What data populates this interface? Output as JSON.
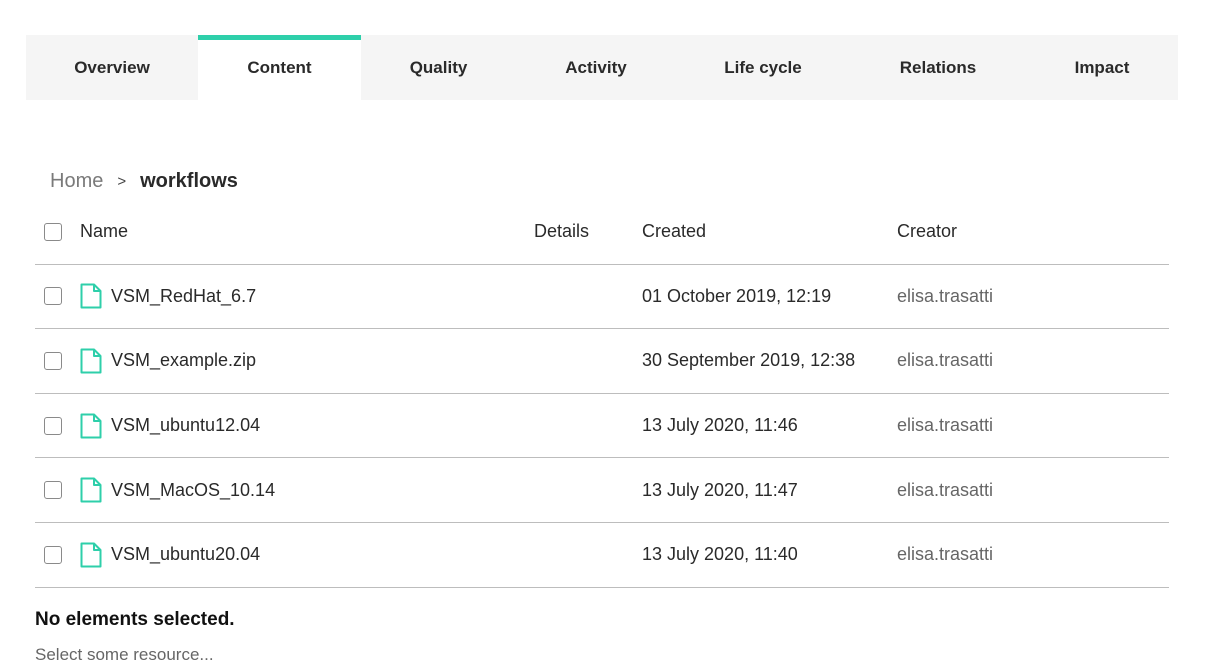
{
  "tabs": [
    {
      "label": "Overview"
    },
    {
      "label": "Content"
    },
    {
      "label": "Quality"
    },
    {
      "label": "Activity"
    },
    {
      "label": "Life cycle"
    },
    {
      "label": "Relations"
    },
    {
      "label": "Impact"
    }
  ],
  "active_tab": "Content",
  "accent_color": "#2ecfaa",
  "breadcrumb": {
    "home": "Home",
    "separator": ">",
    "current": "workflows"
  },
  "table": {
    "columns": {
      "name": "Name",
      "details": "Details",
      "created": "Created",
      "creator": "Creator"
    },
    "rows": [
      {
        "icon": "file-icon",
        "name": "VSM_RedHat_6.7",
        "details": "",
        "created": "01 October 2019, 12:19",
        "creator": "elisa.trasatti"
      },
      {
        "icon": "file-icon",
        "name": "VSM_example.zip",
        "details": "",
        "created": "30 September 2019, 12:38",
        "creator": "elisa.trasatti"
      },
      {
        "icon": "file-icon",
        "name": "VSM_ubuntu12.04",
        "details": "",
        "created": "13 July 2020, 11:46",
        "creator": "elisa.trasatti"
      },
      {
        "icon": "file-icon",
        "name": "VSM_MacOS_10.14",
        "details": "",
        "created": "13 July 2020, 11:47",
        "creator": "elisa.trasatti"
      },
      {
        "icon": "file-icon",
        "name": "VSM_ubuntu20.04",
        "details": "",
        "created": "13 July 2020, 11:40",
        "creator": "elisa.trasatti"
      }
    ]
  },
  "selection": {
    "status": "No elements selected.",
    "hint": "Select some resource..."
  }
}
